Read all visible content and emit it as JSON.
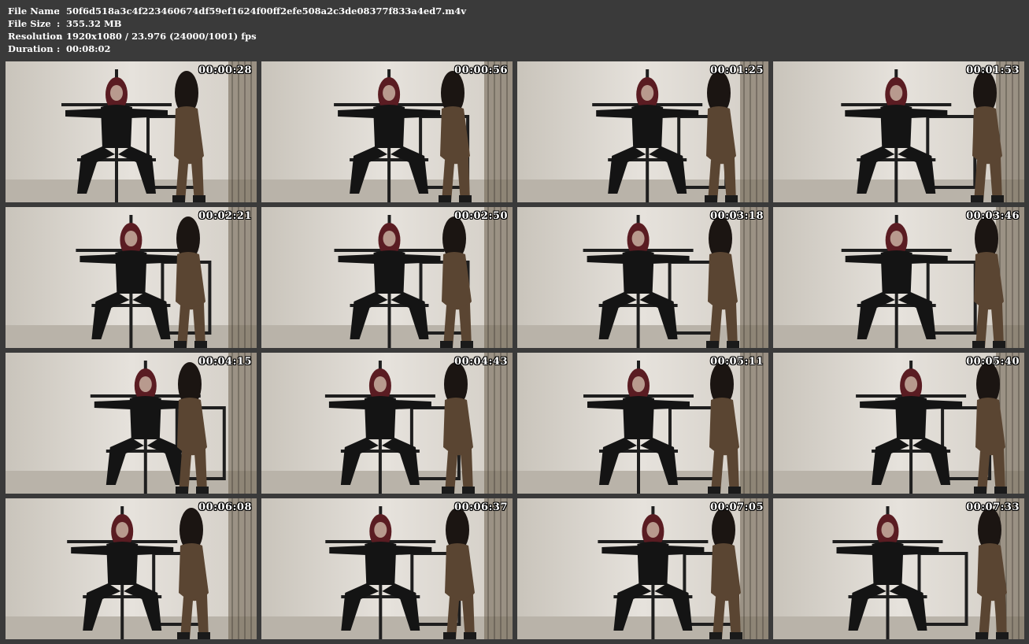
{
  "info": {
    "file_name_label": "File Name",
    "file_name": "50f6d518a3c4f223460674df59ef1624f00ff2efe508a2c3de08377f833a4ed7.m4v",
    "file_size_label": "File Size",
    "file_size": "355.32 MB",
    "resolution_label": "Resolution",
    "resolution": "1920x1080 / 23.976 (24000/1001) fps",
    "duration_label": "Duration",
    "duration": "00:08:02",
    "separator": ":"
  },
  "thumbnails": [
    {
      "timestamp": "00:00:28"
    },
    {
      "timestamp": "00:00:56"
    },
    {
      "timestamp": "00:01:25"
    },
    {
      "timestamp": "00:01:53"
    },
    {
      "timestamp": "00:02:21"
    },
    {
      "timestamp": "00:02:50"
    },
    {
      "timestamp": "00:03:18"
    },
    {
      "timestamp": "00:03:46"
    },
    {
      "timestamp": "00:04:15"
    },
    {
      "timestamp": "00:04:43"
    },
    {
      "timestamp": "00:05:11"
    },
    {
      "timestamp": "00:05:40"
    },
    {
      "timestamp": "00:06:08"
    },
    {
      "timestamp": "00:06:37"
    },
    {
      "timestamp": "00:07:05"
    },
    {
      "timestamp": "00:07:33"
    }
  ],
  "colors": {
    "background": "#3a3a3a",
    "wall": "#d8d4cd",
    "latex_black": "#141414",
    "latex_brown": "#5a4532",
    "hair_red": "#5a1c22",
    "hair_dark": "#1b1512"
  }
}
